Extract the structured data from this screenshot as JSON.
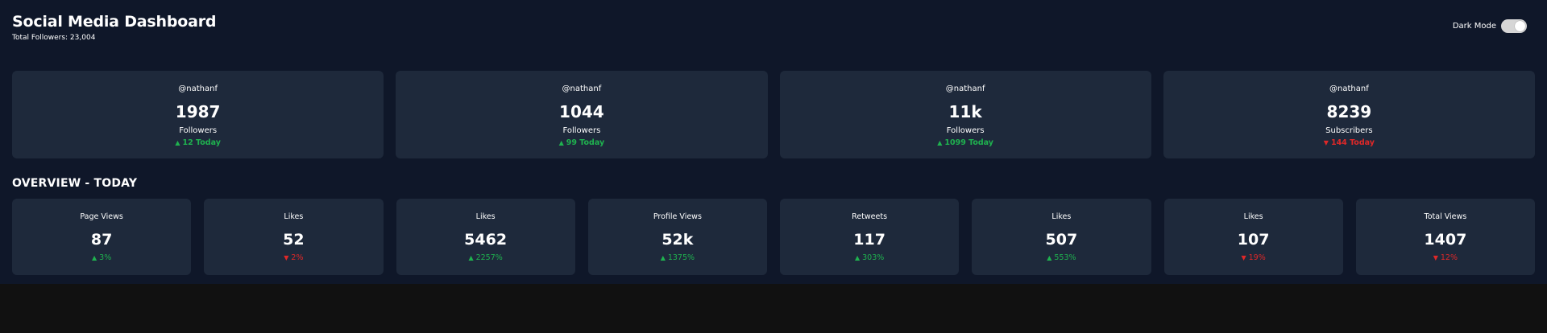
{
  "header": {
    "title": "Social Media Dashboard",
    "total_followers": "Total Followers: 23,004",
    "dark_mode_label": "Dark Mode",
    "dark_mode_on": true
  },
  "colors": {
    "background": "#0f1729",
    "card": "#1e293b",
    "up": "#1fb24f",
    "down": "#e02828"
  },
  "cards": [
    {
      "handle": "@nathanf",
      "count": "1987",
      "label": "Followers",
      "change": "12 Today",
      "direction": "up"
    },
    {
      "handle": "@nathanf",
      "count": "1044",
      "label": "Followers",
      "change": "99 Today",
      "direction": "up"
    },
    {
      "handle": "@nathanf",
      "count": "11k",
      "label": "Followers",
      "change": "1099 Today",
      "direction": "up"
    },
    {
      "handle": "@nathanf",
      "count": "8239",
      "label": "Subscribers",
      "change": "144 Today",
      "direction": "down"
    }
  ],
  "overview": {
    "title": "OVERVIEW - TODAY",
    "items": [
      {
        "label": "Page Views",
        "value": "87",
        "change": "3%",
        "direction": "up"
      },
      {
        "label": "Likes",
        "value": "52",
        "change": "2%",
        "direction": "down"
      },
      {
        "label": "Likes",
        "value": "5462",
        "change": "2257%",
        "direction": "up"
      },
      {
        "label": "Profile Views",
        "value": "52k",
        "change": "1375%",
        "direction": "up"
      },
      {
        "label": "Retweets",
        "value": "117",
        "change": "303%",
        "direction": "up"
      },
      {
        "label": "Likes",
        "value": "507",
        "change": "553%",
        "direction": "up"
      },
      {
        "label": "Likes",
        "value": "107",
        "change": "19%",
        "direction": "down"
      },
      {
        "label": "Total Views",
        "value": "1407",
        "change": "12%",
        "direction": "down"
      }
    ]
  }
}
